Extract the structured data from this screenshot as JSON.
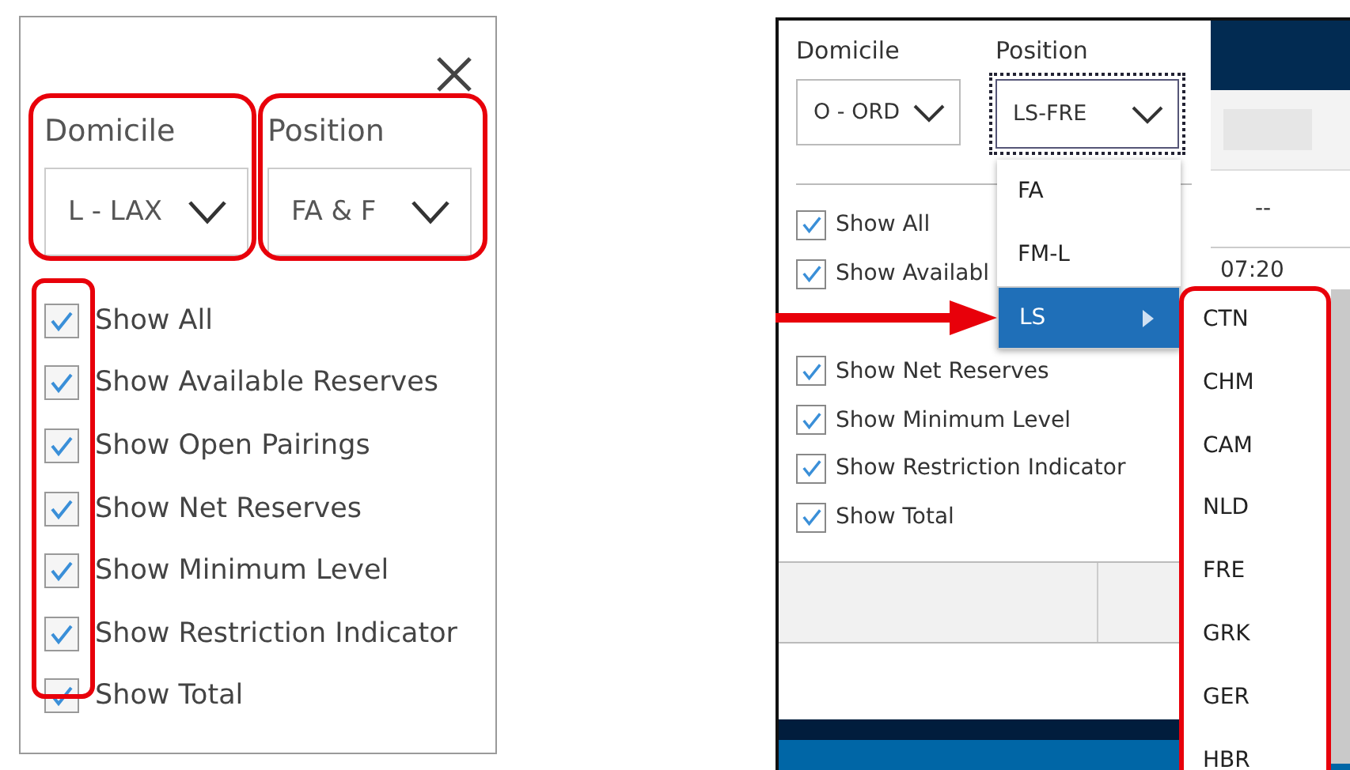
{
  "left_panel": {
    "domicile": {
      "label": "Domicile",
      "value": "L - LAX"
    },
    "position": {
      "label": "Position",
      "value": "FA & F"
    },
    "options": [
      {
        "label": "Show All",
        "checked": true
      },
      {
        "label": "Show Available Reserves",
        "checked": true
      },
      {
        "label": "Show Open Pairings",
        "checked": true
      },
      {
        "label": "Show Net Reserves",
        "checked": true
      },
      {
        "label": "Show Minimum Level",
        "checked": true
      },
      {
        "label": "Show Restriction Indicator",
        "checked": true
      },
      {
        "label": "Show Total",
        "checked": true
      }
    ]
  },
  "right_panel": {
    "domicile": {
      "label": "Domicile",
      "value": "O - ORD"
    },
    "position": {
      "label": "Position",
      "value": "LS-FRE",
      "focused": true
    },
    "options": [
      {
        "label": "Show All",
        "checked": true
      },
      {
        "label": "Show Availabl",
        "checked": true
      },
      {
        "label": "Show Net Reserves",
        "checked": true
      },
      {
        "label": "Show Minimum Level",
        "checked": true
      },
      {
        "label": "Show Restriction Indicator",
        "checked": true
      },
      {
        "label": "Show Total",
        "checked": true
      }
    ],
    "background_cells": [
      "--",
      "07:20"
    ],
    "position_menu": [
      {
        "label": "FA",
        "selected": false,
        "has_submenu": false
      },
      {
        "label": "FM-L",
        "selected": false,
        "has_submenu": false
      },
      {
        "label": "LS",
        "selected": true,
        "has_submenu": true
      }
    ],
    "submenu": [
      "CTN",
      "CHM",
      "CAM",
      "NLD",
      "FRE",
      "GRK",
      "GER",
      "HBR"
    ]
  }
}
